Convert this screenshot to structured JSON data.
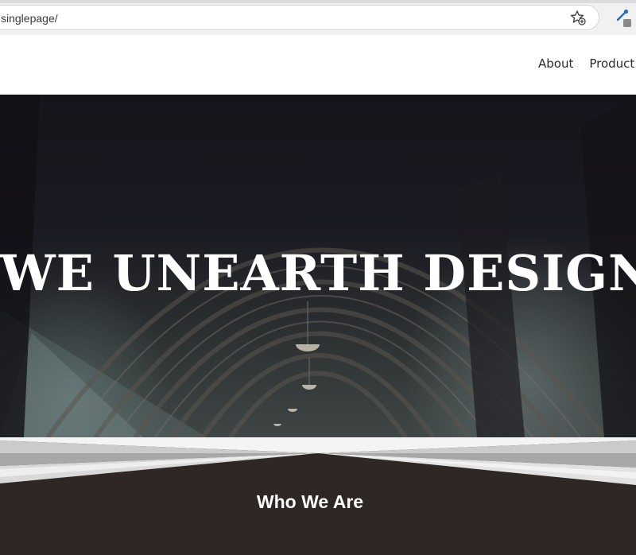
{
  "browser": {
    "url": "singlepage/",
    "icons": [
      "bookmark-star-icon",
      "extension-eyedropper-icon"
    ]
  },
  "nav": {
    "items": [
      "About",
      "Product"
    ]
  },
  "hero": {
    "title": "WE UNEARTH DESIGN"
  },
  "section": {
    "heading": "Who We Are"
  },
  "colors": {
    "hero_dark": "#16141b",
    "section_bg": "#2e2724",
    "text_light": "#ffffff",
    "nav_text": "#2b2b2b"
  }
}
